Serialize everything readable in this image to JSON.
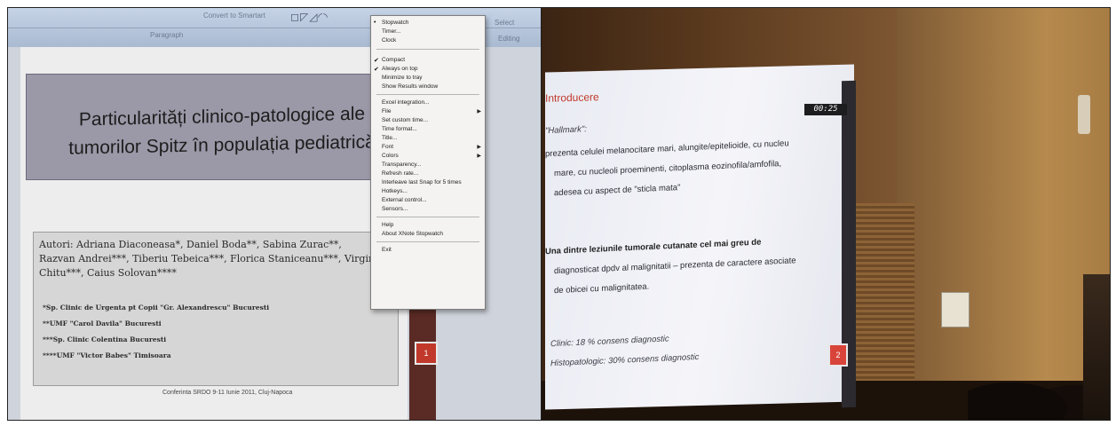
{
  "left_photo": {
    "ribbon": {
      "convert_label": "Convert to Smartart",
      "paragraph_label": "Paragraph",
      "select_label": "Select",
      "editing_label": "Editing"
    },
    "slide": {
      "title": "Particularități clinico-patologice ale tumorilor Spitz în populația pediatrică",
      "authors_line1": "Autori: Adriana Diaconeasa*, Daniel Boda**, Sabina Zurac**,",
      "authors_line2": "Razvan Andrei***, Tiberiu Tebeica***, Florica Staniceanu***, Virgini",
      "authors_line3": "Chitu***, Caius Solovan****",
      "affiliations": [
        "*Sp. Clinic de Urgenta pt Copii \"Gr. Alexandrescu\" Bucuresti",
        "**UMF \"Carol Davila\" Bucuresti",
        "***Sp. Clinic Colentina Bucuresti",
        "****UMF \"Victor Babes\" Timisoara"
      ],
      "conference": "Conferinta SRDO 9-11 Iunie 2011, Cluj-Napoca",
      "slide_number": "1"
    },
    "context_menu": {
      "items": [
        {
          "label": "Stopwatch",
          "mark": "•"
        },
        {
          "label": "Timer...",
          "mark": ""
        },
        {
          "label": "Clock",
          "mark": ""
        },
        {
          "label": "Compact",
          "mark": "✔"
        },
        {
          "label": "Always on top",
          "mark": "✔"
        },
        {
          "label": "Minimize to tray",
          "mark": ""
        },
        {
          "label": "Show Results window",
          "mark": ""
        },
        {
          "label": "Excel integration...",
          "mark": ""
        },
        {
          "label": "File",
          "mark": "",
          "submenu": true
        },
        {
          "label": "Set custom time...",
          "mark": ""
        },
        {
          "label": "Time format...",
          "mark": ""
        },
        {
          "label": "Title...",
          "mark": ""
        },
        {
          "label": "Font",
          "mark": "",
          "submenu": true
        },
        {
          "label": "Colors",
          "mark": "",
          "submenu": true
        },
        {
          "label": "Transparency...",
          "mark": ""
        },
        {
          "label": "Refresh rate...",
          "mark": ""
        },
        {
          "label": "Interleave last Snap for 5 times",
          "mark": ""
        },
        {
          "label": "Hotkeys...",
          "mark": ""
        },
        {
          "label": "External control...",
          "mark": ""
        },
        {
          "label": "Sensors...",
          "mark": ""
        },
        {
          "label": "Help",
          "mark": ""
        },
        {
          "label": "About XNote Stopwatch",
          "mark": ""
        },
        {
          "label": "Exit",
          "mark": ""
        }
      ]
    }
  },
  "right_photo": {
    "timer": "00:25",
    "slide": {
      "title": "Introducere",
      "hallmark": "\"Hallmark\":",
      "para1_line1": "prezenta celulei melanocitare mari, alungite/epitelioide, cu nucleu",
      "para1_line2": "mare, cu nucleoli proeminenti, citoplasma eozinofila/amfofila,",
      "para1_line3": "adesea cu aspect de \"sticla mata\"",
      "para2_line1": "Una dintre leziunile tumorale cutanate cel mai greu de",
      "para2_line2": "diagnosticat dpdv al malignitatii – prezenta de caractere asociate",
      "para2_line3": "de obicei cu malignitatea.",
      "bullet1": "Clinic: 18 % consens diagnostic",
      "bullet2": "Histopatologic: 30% consens diagnostic",
      "slide_number": "2"
    }
  }
}
